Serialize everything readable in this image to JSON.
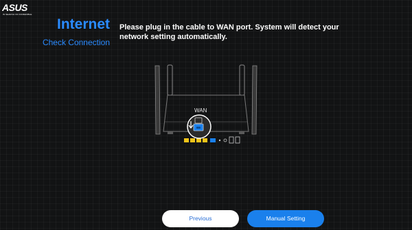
{
  "brand": {
    "name": "ASUS",
    "tagline": "IN SEARCH OF INCREDIBLE"
  },
  "header": {
    "title": "Internet",
    "subtitle": "Check Connection"
  },
  "instruction": {
    "text": "Please plug in the cable to WAN port. System will detect your network setting automatically."
  },
  "router": {
    "port_label": "WAN"
  },
  "buttons": {
    "previous_label": "Previous",
    "manual_label": "Manual Setting"
  },
  "colors": {
    "accent": "#2a8bff",
    "button_blue": "#1a80ec",
    "background": "#121314",
    "port_yellow": "#f0c419"
  },
  "icons": {
    "router": "router-illustration",
    "cable": "ethernet-cable-icon",
    "arrow": "plug-arrow-icon"
  }
}
